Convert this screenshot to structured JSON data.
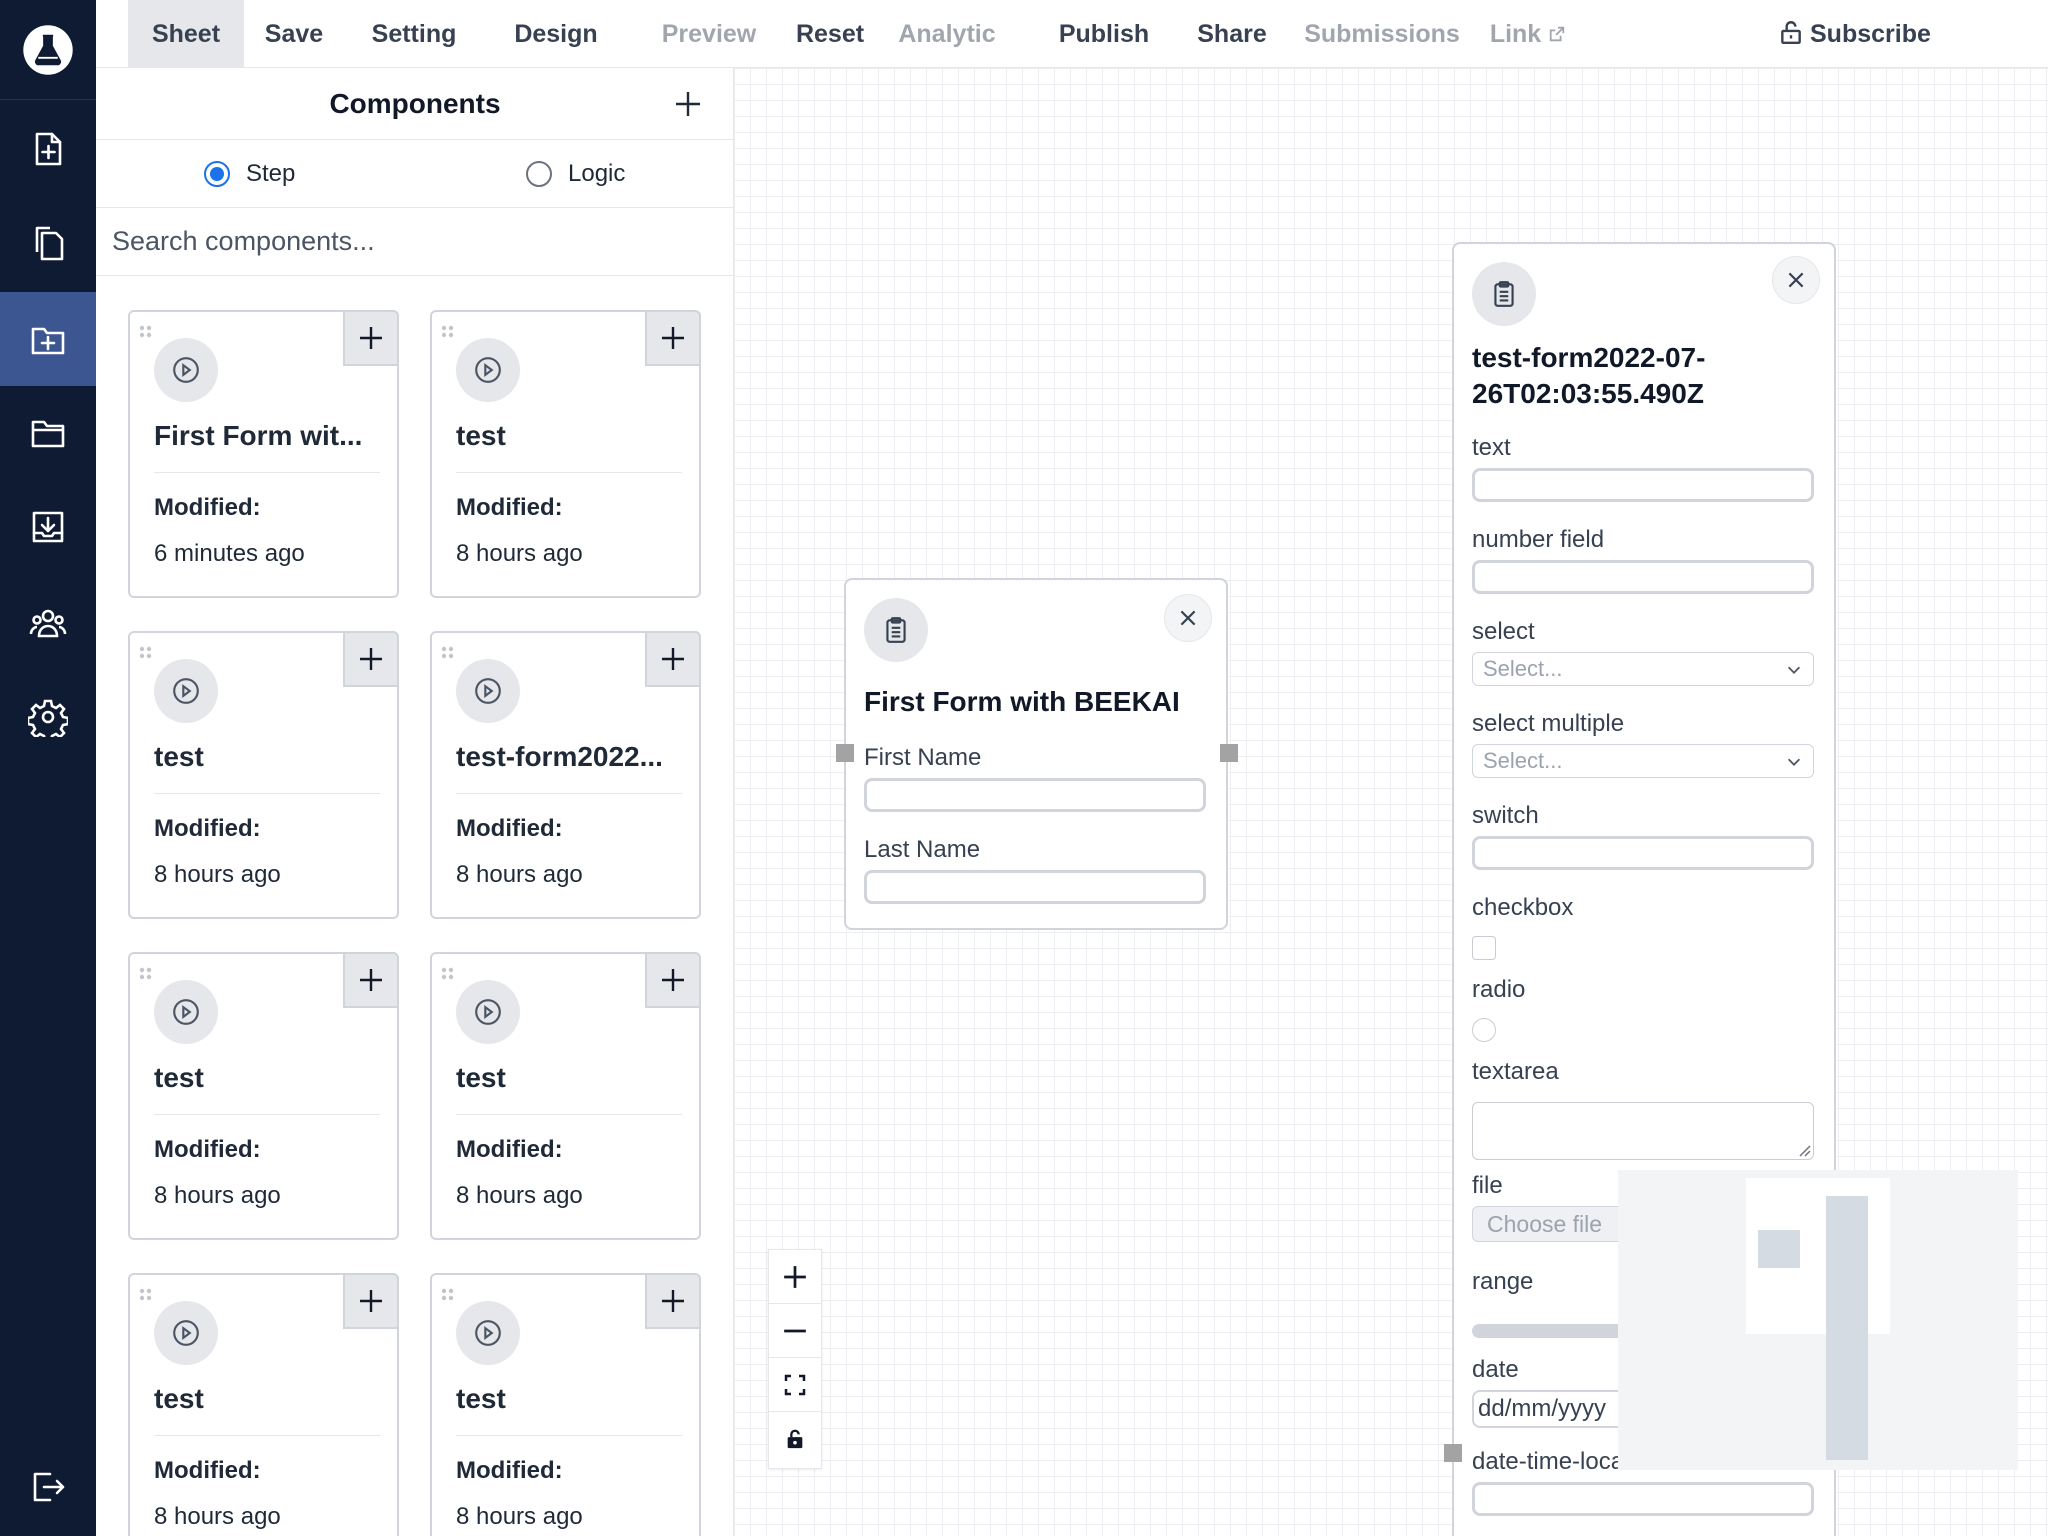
{
  "menu": {
    "items": [
      {
        "label": "Sheet",
        "state": "active"
      },
      {
        "label": "Save",
        "state": "normal"
      },
      {
        "label": "Setting",
        "state": "normal"
      },
      {
        "label": "Design",
        "state": "normal"
      },
      {
        "label": "Preview",
        "state": "disabled"
      },
      {
        "label": "Reset",
        "state": "normal"
      },
      {
        "label": "Analytic",
        "state": "disabled"
      },
      {
        "label": "Publish",
        "state": "normal"
      },
      {
        "label": "Share",
        "state": "normal"
      },
      {
        "label": "Submissions",
        "state": "disabled"
      },
      {
        "label": "Link",
        "state": "disabled"
      }
    ],
    "subscribe": "Subscribe"
  },
  "panel": {
    "title": "Components",
    "radio_step": "Step",
    "radio_logic": "Logic",
    "search_placeholder": "Search components...",
    "modified_label": "Modified:",
    "cards": [
      {
        "name": "First Form wit...",
        "modified": "6 minutes ago"
      },
      {
        "name": "test",
        "modified": "8 hours ago"
      },
      {
        "name": "test",
        "modified": "8 hours ago"
      },
      {
        "name": "test-form2022...",
        "modified": "8 hours ago"
      },
      {
        "name": "test",
        "modified": "8 hours ago"
      },
      {
        "name": "test",
        "modified": "8 hours ago"
      },
      {
        "name": "test",
        "modified": "8 hours ago"
      },
      {
        "name": "test",
        "modified": "8 hours ago"
      }
    ]
  },
  "node1": {
    "title": "First Form with BEEKAI",
    "fields": [
      "First Name",
      "Last Name"
    ]
  },
  "node2": {
    "title_line1": "test-form2022-07-",
    "title_line2": "26T02:03:55.490Z",
    "labels": {
      "text": "text",
      "number": "number field",
      "select": "select",
      "select_multiple": "select multiple",
      "switch": "switch",
      "checkbox": "checkbox",
      "radio": "radio",
      "textarea": "textarea",
      "file": "file",
      "range": "range",
      "date": "date",
      "datetime": "date-time-local"
    },
    "select_placeholder": "Select...",
    "choose_file": "Choose file",
    "date_placeholder": "dd/mm/yyyy"
  },
  "colors": {
    "rail_bg": "#0f1b33",
    "rail_active": "#3b5690",
    "radio_accent": "#1a73e8"
  }
}
